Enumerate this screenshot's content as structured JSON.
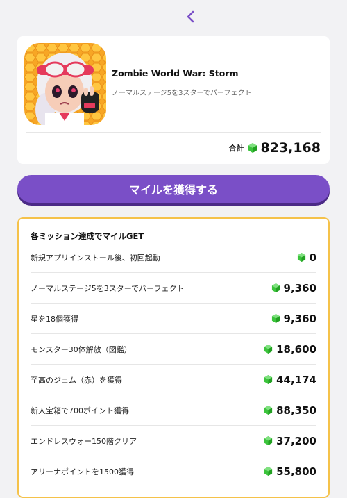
{
  "header": {
    "back_icon": "chevron-left-icon"
  },
  "app": {
    "title": "Zombie World War: Storm",
    "subtitle": "ノーマルステージ5を3スターでパーフェクト",
    "total_label": "合計",
    "total_value": "823,168"
  },
  "cta": {
    "label": "マイルを獲得する"
  },
  "missions": {
    "title": "各ミッション達成でマイルGET",
    "items": [
      {
        "label": "新規アプリインストール後、初回起動",
        "value": "0"
      },
      {
        "label": "ノーマルステージ5を3スターでパーフェクト",
        "value": "9,360"
      },
      {
        "label": "星を18個獲得",
        "value": "9,360"
      },
      {
        "label": "モンスター30体解放（図鑑）",
        "value": "18,600"
      },
      {
        "label": "至高のジェム（赤）を獲得",
        "value": "44,174"
      },
      {
        "label": "新人宝箱で700ポイント獲得",
        "value": "88,350"
      },
      {
        "label": "エンドレスウォー150階クリア",
        "value": "37,200"
      },
      {
        "label": "アリーナポイントを1500獲得",
        "value": "55,800"
      }
    ]
  },
  "colors": {
    "accent": "#7a4fc7",
    "border": "#f5c24a",
    "gem": "#3cc43c"
  }
}
